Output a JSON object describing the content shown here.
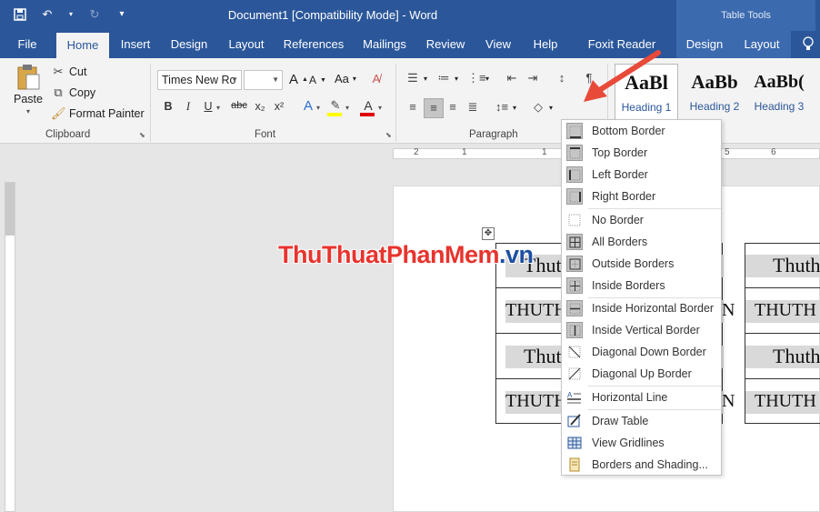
{
  "window": {
    "title": "Document1 [Compatibility Mode]  -  Word",
    "contextual_band": "Table Tools"
  },
  "tabs": [
    {
      "label": "File"
    },
    {
      "label": "Home"
    },
    {
      "label": "Insert"
    },
    {
      "label": "Design"
    },
    {
      "label": "Layout"
    },
    {
      "label": "References"
    },
    {
      "label": "Mailings"
    },
    {
      "label": "Review"
    },
    {
      "label": "View"
    },
    {
      "label": "Help"
    },
    {
      "label": "Foxit Reader PDF"
    },
    {
      "label": "Design"
    },
    {
      "label": "Layout"
    }
  ],
  "clipboard": {
    "paste": "Paste",
    "cut": "Cut",
    "copy": "Copy",
    "format_painter": "Format Painter",
    "group_label": "Clipboard"
  },
  "font": {
    "family": "Times New Ro",
    "size": "",
    "bold": "B",
    "italic": "I",
    "underline": "U",
    "strike": "abc",
    "subscript": "x₂",
    "superscript": "x²",
    "grow": "A",
    "shrink": "A",
    "case": "Aa",
    "group_label": "Font"
  },
  "paragraph": {
    "group_label": "Paragraph"
  },
  "styles": [
    {
      "sample": "AaBl",
      "name": "Heading 1"
    },
    {
      "sample": "AaBb",
      "name": "Heading 2"
    },
    {
      "sample": "AaBb(",
      "name": "Heading 3"
    }
  ],
  "ruler": {
    "numbers": [
      "2",
      "1",
      "1",
      "5",
      "6"
    ]
  },
  "watermark": {
    "main": "ThuThuatPhanMem",
    "suffix": ".vn"
  },
  "table": {
    "rows": [
      {
        "left": "Thut",
        "mid": "",
        "right": "Thuth"
      },
      {
        "left": "THUTH",
        "mid": "N",
        "right": "THUTH"
      },
      {
        "left": "Thut",
        "mid": "",
        "right": "Thuth"
      },
      {
        "left": "THUTH",
        "mid": "N",
        "right": "THUTH"
      }
    ]
  },
  "borders_menu": {
    "items": [
      {
        "label": "Bottom Border",
        "icon": "bottom-border-icon"
      },
      {
        "label": "Top Border",
        "icon": "top-border-icon"
      },
      {
        "label": "Left Border",
        "icon": "left-border-icon"
      },
      {
        "label": "Right Border",
        "icon": "right-border-icon"
      },
      {
        "label": "No Border",
        "icon": "no-border-icon"
      },
      {
        "label": "All Borders",
        "icon": "all-borders-icon"
      },
      {
        "label": "Outside Borders",
        "icon": "outside-borders-icon"
      },
      {
        "label": "Inside Borders",
        "icon": "inside-borders-icon"
      },
      {
        "label": "Inside Horizontal Border",
        "icon": "inside-horizontal-border-icon"
      },
      {
        "label": "Inside Vertical Border",
        "icon": "inside-vertical-border-icon"
      },
      {
        "label": "Diagonal Down Border",
        "icon": "diagonal-down-border-icon"
      },
      {
        "label": "Diagonal Up Border",
        "icon": "diagonal-up-border-icon"
      },
      {
        "label": "Horizontal Line",
        "icon": "horizontal-line-icon"
      },
      {
        "label": "Draw Table",
        "icon": "draw-table-icon"
      },
      {
        "label": "View Gridlines",
        "icon": "view-gridlines-icon"
      },
      {
        "label": "Borders and Shading...",
        "icon": "borders-shading-icon"
      }
    ]
  },
  "colors": {
    "accent": "#2b579a",
    "highlight": "#ffff00",
    "font_color": "#e00000",
    "arrow": "#e84a3a"
  }
}
